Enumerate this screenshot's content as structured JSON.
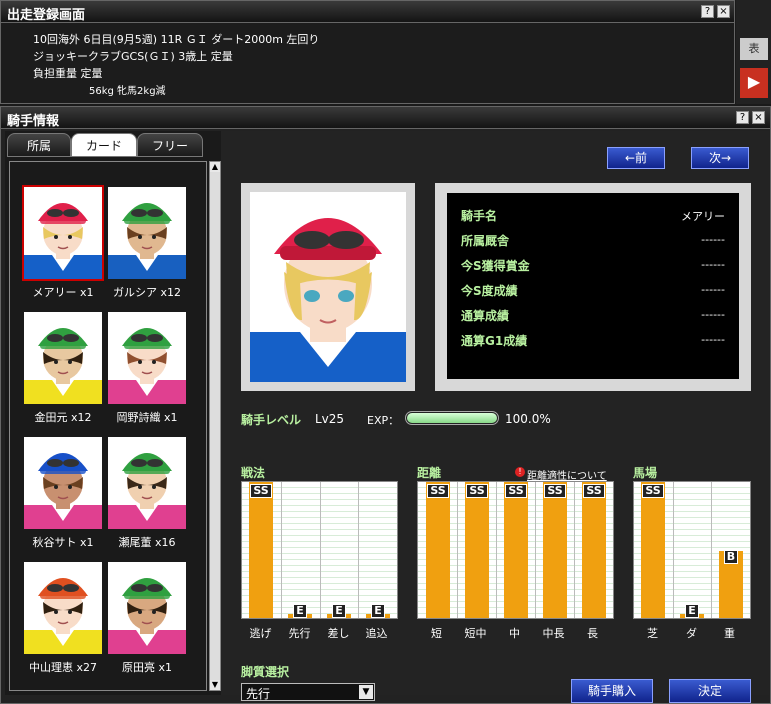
{
  "top_window": {
    "title": "出走登録画面",
    "help_btn": "?",
    "close_btn": "×",
    "lines": [
      "10回海外 6日目(9月5週) 11R ＧＩ ダート2000m 左回り",
      "ジョッキークラブGCS(ＧＩ) 3歳上 定量",
      "負担重量 定量",
      "56kg 牝馬2kg減"
    ]
  },
  "peek": {
    "a": "表",
    "b": "▶"
  },
  "main_window": {
    "title": "騎手情報",
    "help_btn": "?",
    "close_btn": "×"
  },
  "tabs": [
    "所属",
    "カード",
    "フリー"
  ],
  "scroll": {
    "up": "▲",
    "down": "▼"
  },
  "cards": [
    {
      "name": "メアリー x1",
      "helmet": "#e0204a",
      "silks": "#1560c8",
      "hair": "#e8c860",
      "skin": "#f8dcc8",
      "selected": true
    },
    {
      "name": "ガルシア x12",
      "helmet": "#30a040",
      "silks": "#1860c0",
      "hair": "#6a4020",
      "skin": "#e0b890",
      "selected": false
    },
    {
      "name": "金田元 x12",
      "helmet": "#30a040",
      "silks": "#f0e020",
      "hair": "#302010",
      "skin": "#e8c8a0",
      "selected": false
    },
    {
      "name": "岡野詩織 x1",
      "helmet": "#30a040",
      "silks": "#e04090",
      "hair": "#905030",
      "skin": "#f8dcc8",
      "selected": false
    },
    {
      "name": "秋谷サト x1",
      "helmet": "#1850c8",
      "silks": "#e04090",
      "hair": "#6a4020",
      "skin": "#c89070",
      "selected": false
    },
    {
      "name": "瀬尾董 x16",
      "helmet": "#30a040",
      "silks": "#e04090",
      "hair": "#3a2818",
      "skin": "#f0d0b0",
      "selected": false
    },
    {
      "name": "中山理恵 x27",
      "helmet": "#e05020",
      "silks": "#f0e020",
      "hair": "#302010",
      "skin": "#f8dcc8",
      "selected": false
    },
    {
      "name": "原田亮 x1",
      "helmet": "#30a040",
      "silks": "#e04090",
      "hair": "#302010",
      "skin": "#d8a880",
      "selected": false
    }
  ],
  "nav": {
    "prev": "←前",
    "next": "次→"
  },
  "info": {
    "rows": [
      {
        "label": "騎手名",
        "value": "メアリー"
      },
      {
        "label": "所属厩舎",
        "value": "------"
      },
      {
        "label": "今S獲得賞金",
        "value": "------"
      },
      {
        "label": "今S度成績",
        "value": "------"
      },
      {
        "label": "通算成績",
        "value": "------"
      },
      {
        "label": "通算G1成績",
        "value": "------"
      }
    ]
  },
  "level": {
    "label": "騎手レベル",
    "value": "Lv25",
    "exp_label": "EXP：",
    "exp_pct_text": "100.0%",
    "exp_fraction": 1.0
  },
  "ability": {
    "tactics": {
      "label": "戦法",
      "items": [
        {
          "name": "逃げ",
          "grade": "SS",
          "fill": 1.0
        },
        {
          "name": "先行",
          "grade": "E",
          "fill": 0.03
        },
        {
          "name": "差し",
          "grade": "E",
          "fill": 0.03
        },
        {
          "name": "追込",
          "grade": "E",
          "fill": 0.03
        }
      ]
    },
    "distance": {
      "label": "距離",
      "help": "距離適性について",
      "help_icon": "!",
      "items": [
        {
          "name": "短",
          "grade": "SS",
          "fill": 1.0
        },
        {
          "name": "短中",
          "grade": "SS",
          "fill": 1.0
        },
        {
          "name": "中",
          "grade": "SS",
          "fill": 1.0
        },
        {
          "name": "中長",
          "grade": "SS",
          "fill": 1.0
        },
        {
          "name": "長",
          "grade": "SS",
          "fill": 1.0
        }
      ]
    },
    "track": {
      "label": "馬場",
      "items": [
        {
          "name": "芝",
          "grade": "SS",
          "fill": 1.0
        },
        {
          "name": "ダ",
          "grade": "E",
          "fill": 0.03
        },
        {
          "name": "重",
          "grade": "B",
          "fill": 0.49
        }
      ]
    }
  },
  "style": {
    "label": "脚質選択",
    "selected": "先行",
    "arrow": "▼"
  },
  "actions": {
    "buy": "騎手購入",
    "confirm": "決定"
  },
  "colors": {
    "bar": "#f0a010",
    "label_green": "#b8f0a0",
    "button_blue": "#2040b0"
  }
}
